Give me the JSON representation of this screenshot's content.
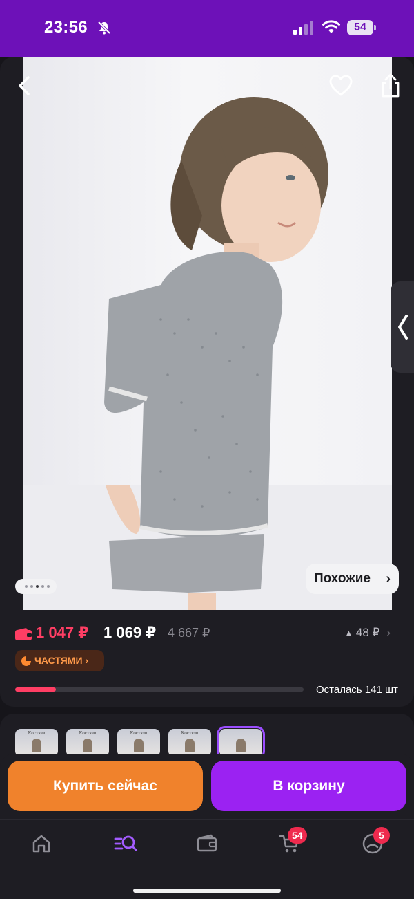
{
  "status_bar": {
    "time": "23:56",
    "battery": "54",
    "icons": [
      "bell-muted-icon",
      "signal-icon",
      "wifi-icon",
      "battery-icon"
    ]
  },
  "product": {
    "similar_label": "Похожие",
    "similar_chevron": "›",
    "image_page": {
      "current": 3,
      "total": 5
    },
    "price_card": "1 047 ₽",
    "price": "1 069 ₽",
    "price_old": "4 667 ₽",
    "price_delta": "48 ₽",
    "price_delta_arrow": "▲",
    "chevron": "›",
    "installments_label": "ЧАСТЯМИ",
    "stock_label": "Осталась 141 шт",
    "stock_fraction": 0.14
  },
  "thumbnails": [
    {
      "caption": "Костюм"
    },
    {
      "caption": "Костюм"
    },
    {
      "caption": "Костюм"
    },
    {
      "caption": "Костюм"
    },
    {
      "caption": ""
    }
  ],
  "actions": {
    "buy_now": "Купить сейчас",
    "add_to_cart": "В корзину"
  },
  "tabbar": {
    "items": [
      "home-icon",
      "catalog-search-icon",
      "wallet-icon",
      "cart-icon",
      "profile-icon"
    ],
    "cart_badge": "54",
    "profile_badge": "5"
  },
  "colors": {
    "status_bar": "#6d11b8",
    "buy": "#f0822c",
    "cart": "#9b22f2",
    "price_card": "#ff3e64",
    "accent": "#9b4dff"
  }
}
